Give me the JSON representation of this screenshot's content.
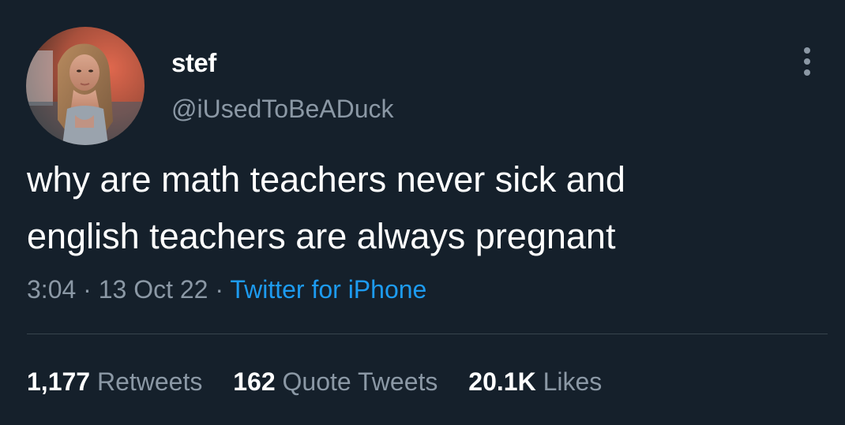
{
  "theme": {
    "background": "#15202b",
    "text_primary": "#ffffff",
    "text_secondary": "#8b98a5",
    "link": "#1d9bf0",
    "divider": "#38444d"
  },
  "author": {
    "display_name": "stef",
    "handle": "@iUsedToBeADuck",
    "avatar_icon": "profile-photo"
  },
  "tweet": {
    "text": "why are math teachers never sick and\nenglish teachers are always pregnant"
  },
  "meta": {
    "time": "3:04",
    "separator": " · ",
    "date": "13 Oct 22",
    "source": "Twitter for iPhone"
  },
  "stats": {
    "retweets": {
      "count": "1,177",
      "label": "Retweets"
    },
    "quote_tweets": {
      "count": "162",
      "label": "Quote Tweets"
    },
    "likes": {
      "count": "20.1K",
      "label": "Likes"
    }
  },
  "more_icon": "more-vertical-icon"
}
